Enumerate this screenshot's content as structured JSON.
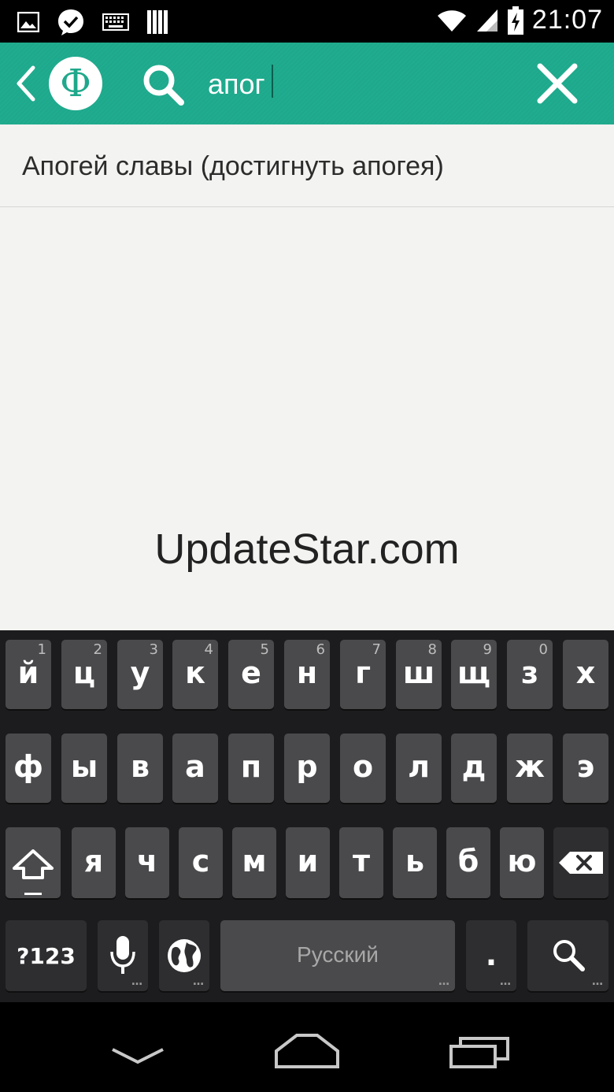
{
  "status_bar": {
    "time": "21:07",
    "left_icons": [
      "gallery-icon",
      "messenger-check-icon",
      "keyboard-icon",
      "storage-icon"
    ],
    "right_icons": [
      "wifi-icon",
      "signal-icon",
      "battery-charging-icon"
    ]
  },
  "app_bar": {
    "logo_glyph": "Ф",
    "search_value": "апог",
    "accent_color": "#1fa88b"
  },
  "results": [
    {
      "text": "Апогей славы (достигнуть апогея)"
    }
  ],
  "watermark": "UpdateStar.com",
  "keyboard": {
    "row1": [
      {
        "label": "й",
        "hint": "1"
      },
      {
        "label": "ц",
        "hint": "2"
      },
      {
        "label": "у",
        "hint": "3"
      },
      {
        "label": "к",
        "hint": "4"
      },
      {
        "label": "е",
        "hint": "5"
      },
      {
        "label": "н",
        "hint": "6"
      },
      {
        "label": "г",
        "hint": "7"
      },
      {
        "label": "ш",
        "hint": "8"
      },
      {
        "label": "щ",
        "hint": "9"
      },
      {
        "label": "з",
        "hint": "0"
      },
      {
        "label": "х",
        "hint": ""
      }
    ],
    "row2": [
      "ф",
      "ы",
      "в",
      "а",
      "п",
      "р",
      "о",
      "л",
      "д",
      "ж",
      "э"
    ],
    "row3": [
      "я",
      "ч",
      "с",
      "м",
      "и",
      "т",
      "ь",
      "б",
      "ю"
    ],
    "symbols_label": "?123",
    "space_label": "Русский",
    "period_label": "."
  }
}
